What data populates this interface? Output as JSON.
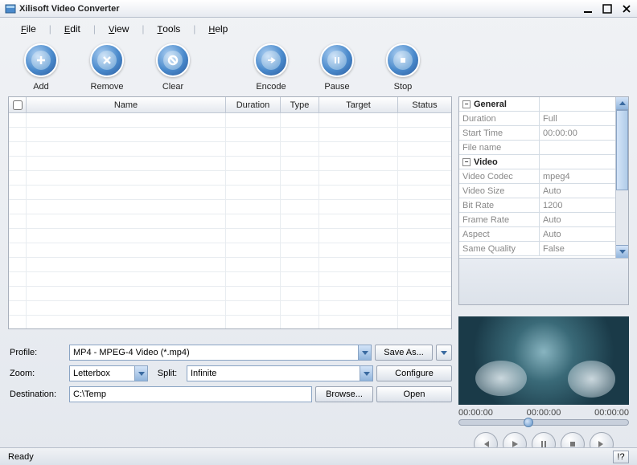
{
  "app": {
    "title": "Xilisoft Video Converter"
  },
  "menu": {
    "file": "File",
    "edit": "Edit",
    "view": "View",
    "tools": "Tools",
    "help": "Help"
  },
  "toolbar": {
    "add": "Add",
    "remove": "Remove",
    "clear": "Clear",
    "encode": "Encode",
    "pause": "Pause",
    "stop": "Stop"
  },
  "grid": {
    "headers": {
      "name": "Name",
      "duration": "Duration",
      "type": "Type",
      "target": "Target",
      "status": "Status"
    }
  },
  "form": {
    "profile_label": "Profile:",
    "profile_value": "MP4 - MPEG-4 Video (*.mp4)",
    "saveas": "Save As...",
    "zoom_label": "Zoom:",
    "zoom_value": "Letterbox",
    "split_label": "Split:",
    "split_value": "Infinite",
    "configure": "Configure",
    "dest_label": "Destination:",
    "dest_value": "C:\\Temp",
    "browse": "Browse...",
    "open": "Open"
  },
  "props": {
    "general": "General",
    "duration_k": "Duration",
    "duration_v": "Full",
    "starttime_k": "Start Time",
    "starttime_v": "00:00:00",
    "filename_k": "File name",
    "filename_v": "",
    "video": "Video",
    "codec_k": "Video Codec",
    "codec_v": "mpeg4",
    "size_k": "Video Size",
    "size_v": "Auto",
    "bitrate_k": "Bit Rate",
    "bitrate_v": "1200",
    "framerate_k": "Frame Rate",
    "framerate_v": "Auto",
    "aspect_k": "Aspect",
    "aspect_v": "Auto",
    "samequality_k": "Same Quality",
    "samequality_v": "False"
  },
  "timeline": {
    "t1": "00:00:00",
    "t2": "00:00:00",
    "t3": "00:00:00"
  },
  "status": {
    "text": "Ready",
    "help": "!?"
  }
}
